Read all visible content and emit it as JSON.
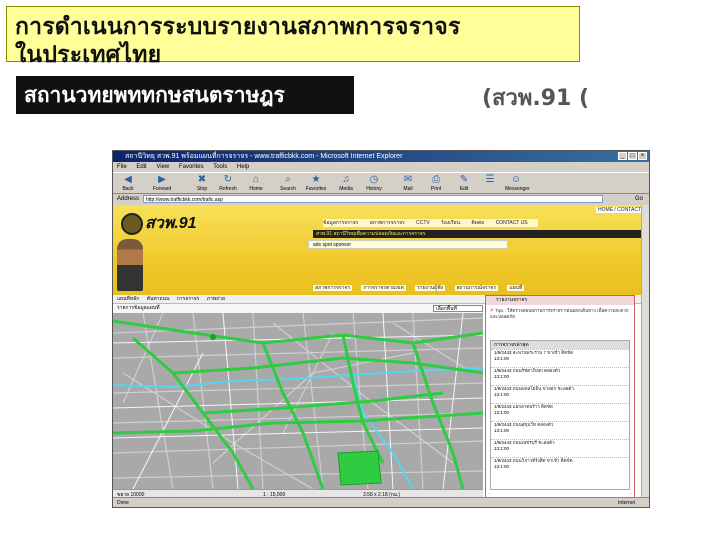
{
  "slide": {
    "title_line1": "การดำเนนการระบบรายงานสภาพการจราจร",
    "title_line2": "ในประเทศไทย",
    "subtitle": "สถานวทยพททกษสนตราษฎร",
    "subtitle_code": "(สวพ.91 ("
  },
  "browser": {
    "window_title": "สถานีวิทยุ สวพ.91 พร้อมแผนที่การจราจร - www.trafficbkk.com - Microsoft Internet Explorer",
    "menu": [
      "File",
      "Edit",
      "View",
      "Favorites",
      "Tools",
      "Help"
    ],
    "toolbar": [
      {
        "label": "Back",
        "icon": "back-arrow-icon",
        "glyph": "◀"
      },
      {
        "label": "Forward",
        "icon": "forward-arrow-icon",
        "glyph": "▶"
      },
      {
        "label": "Stop",
        "icon": "stop-icon",
        "glyph": "✖"
      },
      {
        "label": "Refresh",
        "icon": "refresh-icon",
        "glyph": "↻"
      },
      {
        "label": "Home",
        "icon": "home-icon",
        "glyph": "⌂"
      },
      {
        "label": "Search",
        "icon": "search-icon",
        "glyph": "⌕"
      },
      {
        "label": "Favorites",
        "icon": "favorites-icon",
        "glyph": "★"
      },
      {
        "label": "Media",
        "icon": "media-icon",
        "glyph": "♫"
      },
      {
        "label": "History",
        "icon": "history-icon",
        "glyph": "◷"
      },
      {
        "label": "Mail",
        "icon": "mail-icon",
        "glyph": "✉"
      },
      {
        "label": "Print",
        "icon": "print-icon",
        "glyph": "⎙"
      },
      {
        "label": "Edit",
        "icon": "edit-icon",
        "glyph": "✎"
      },
      {
        "label": "",
        "icon": "discuss-icon",
        "glyph": "☰"
      },
      {
        "label": "Messenger",
        "icon": "messenger-icon",
        "glyph": "☺"
      }
    ],
    "address_label": "Address",
    "address_value": "http://www.trafficbkk.com/trafic.asp",
    "go_label": "Go",
    "status_text": "Done",
    "status_zone": "Internet"
  },
  "site": {
    "logo": "สวพ.91",
    "logo_small": "สถานี",
    "top_links": "HOME / CONTACT",
    "nav1": [
      "ข้อมูลการจราจร",
      "สภาพการจราจร",
      "CCTV",
      "ร้องเรียน",
      "ติดต่อ"
    ],
    "contact": "CONTACT US",
    "ticker": "สวพ.91 สถานีวิทยุเพื่อความปลอดภัยและการจราจร",
    "ad": "ads spot sponsor",
    "nav2": [
      "สภาพการจราจร",
      "การจราจรตามเขต",
      "รายงานผู้ฟัง",
      "สถานการณ์จราจร",
      "แผนที่"
    ],
    "map_tools": [
      "แผนที่หลัก",
      "ค้นหาถนน",
      "การจราจร",
      "ภาพถ่าย"
    ],
    "map_tools2": "รายการข้อมูลแผนที่",
    "select_value": "เลือกพื้นที่",
    "map_scale": "1 : 15,000",
    "map_zoom": "3.58 x 2.18 (กม.)",
    "map_left": "ขยาย 10000",
    "panel_title": "รายงานจราจร",
    "panel_tip": "Tips : ให้ตรวจสอบสภาพการจราจร ก่อนออกเดินทาง เพื่อความสะดวกและปลอดภัย",
    "panel_table_head": "การจราจรล่าสุด",
    "reports": [
      {
        "date": "1/9/2443",
        "time": "13:1:00",
        "text": "สะพานพระราม 7 ขาเข้า ติดขัด"
      },
      {
        "date": "1/9/2443",
        "time": "13:1:00",
        "text": "ถนนรัชดาภิเษก คล่องตัว"
      },
      {
        "date": "1/9/2443",
        "time": "13:1:00",
        "text": "ถนนพหลโยธิน ขาออก ชะลอตัว"
      },
      {
        "date": "1/9/2443",
        "time": "13:1:00",
        "text": "แยกลาดพร้าว ติดขัด"
      },
      {
        "date": "1/9/2443",
        "time": "13:1:00",
        "text": "ถนนสุขุมวิท คล่องตัว"
      },
      {
        "date": "1/9/2443",
        "time": "13:1:00",
        "text": "ถนนเพชรบุรี ชะลอตัว"
      },
      {
        "date": "1/9/2443",
        "time": "13:1:00",
        "text": "ถนนวิภาวดีรังสิต ขาเข้า ติดขัด"
      }
    ]
  },
  "colors": {
    "title_box": "#ffff99",
    "subtitle_box": "#111111",
    "header_yellow": "#f2c92b",
    "road_green": "#2ecc40",
    "map_gray": "#a9a9a9",
    "water_cyan": "#55d6f0"
  }
}
